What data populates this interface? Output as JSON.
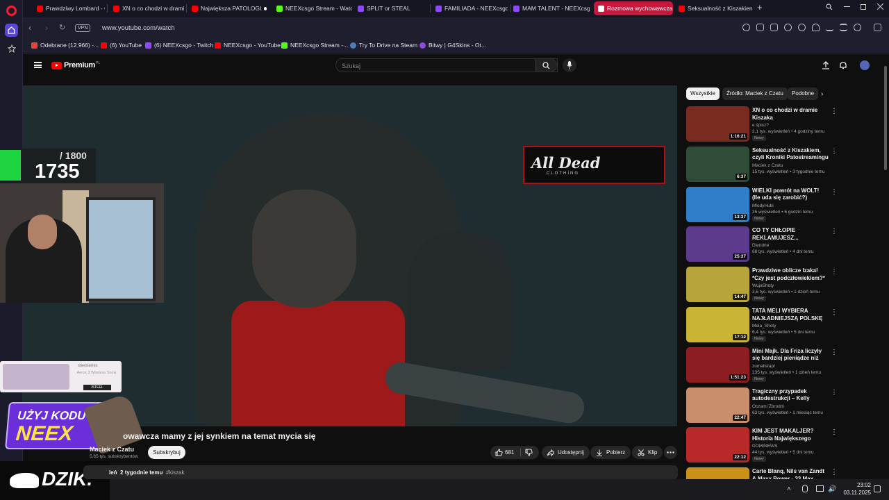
{
  "browser": {
    "tabs": [
      {
        "label": "Prawdziwy Lombard - Od",
        "icon": "youtube",
        "active": false
      },
      {
        "label": "XN o co chodzi w dramie",
        "icon": "youtube",
        "active": false
      },
      {
        "label": "Największa PATOLOGIA N",
        "icon": "youtube",
        "active": false
      },
      {
        "label": "NEEXcsgo Stream - Watch",
        "icon": "kick",
        "active": false
      },
      {
        "label": "SPLIT or STEAL",
        "icon": "twitch",
        "active": false
      },
      {
        "label": "FAMILIADA - NEEXcsgo",
        "icon": "twitch",
        "active": false
      },
      {
        "label": "MAM TALENT - NEEXcsgo",
        "icon": "twitch",
        "active": false
      },
      {
        "label": "Rozmowa wychowawcza",
        "icon": "youtube",
        "active": true
      },
      {
        "label": "Seksualność z Kiszakiem,",
        "icon": "youtube",
        "active": false
      }
    ],
    "new_tab": "+",
    "vpn": "VPN",
    "url": "www.youtube.com/watch",
    "bookmarks": [
      {
        "label": "Odebrane (12 966) -...",
        "icon": "gmail"
      },
      {
        "label": "(6) YouTube",
        "icon": "youtube"
      },
      {
        "label": "(6) NEEXcsgo - Twitch",
        "icon": "twitch"
      },
      {
        "label": "NEEXcsgo - YouTube",
        "icon": "youtube"
      },
      {
        "label": "NEEXcsgo Stream -...",
        "icon": "kick"
      },
      {
        "label": "Try To Drive na Steam",
        "icon": "steam"
      },
      {
        "label": "Bitwy | G4Skins - Ot...",
        "icon": "g4skins"
      }
    ]
  },
  "youtube": {
    "logo": "Premium",
    "logo_region": "PL",
    "search_placeholder": "Szukaj",
    "video": {
      "sponsor_title": "All Dead",
      "sponsor_sub": "CLOTHING",
      "title": "owawcza mamy z jej synkiem na temat mycia się",
      "channel": "Maciek z Czatu",
      "subscribers": "5,65 tys. subskrybentów",
      "subscribe_label": "Subskrybuj",
      "likes": "681",
      "share_label": "Udostępnij",
      "download_label": "Pobierz",
      "clip_label": "Klip",
      "desc_views": "leń",
      "desc_date": "2 tygodnie temu",
      "desc_tag": "#kiszak"
    },
    "overlay": {
      "goal": "/ 1800",
      "count": "1735",
      "steel_brand": "steelseries",
      "steel_product": "Aerox 3 Wireless Snow",
      "steel_cta": "ISTEEL",
      "code_line1": "UŻYJ KODU",
      "code_line2": "NEEX",
      "dzik": "DZIK."
    },
    "chips": [
      "Wszystkie",
      "Źródło: Maciek z Czatu",
      "Podobne"
    ],
    "recommendations": [
      {
        "title": "XN o co chodzi w dramie Kiszaka",
        "channel": "e śpisz?",
        "meta": "2,1 tys. wyświetleń • 4 godziny temu",
        "duration": "1:16:21",
        "badge": "Nowy",
        "color": "#7a2b1f"
      },
      {
        "title": "Seksualność z Kiszakiem, czyli Kroniki Patostreamingu w ...",
        "channel": "Maciek z Czatu",
        "meta": "15 tys. wyświetleń • 3 tygodnie temu",
        "duration": "6:37",
        "badge": "",
        "color": "#2e4c36"
      },
      {
        "title": "WIELKI powrót na WOLT! (Ile uda się zarobić?)",
        "channel": "MlodyHubi",
        "meta": "35 wyświetleń • 6 godzin temu",
        "duration": "13:37",
        "badge": "Nowy",
        "color": "#2f7ec9"
      },
      {
        "title": "CO TY CHŁOPIE REKLAMUJESZ...",
        "channel": "Diendrie",
        "meta": "68 tys. wyświetleń • 4 dni temu",
        "duration": "25:37",
        "badge": "",
        "color": "#5c3a8c"
      },
      {
        "title": "Prawdziwe oblicze Izaka! *Czy jest podczłowiekiem?*",
        "channel": "WujaShoty",
        "meta": "3,6 tys. wyświetleń • 1 dzień temu",
        "duration": "14:47",
        "badge": "Nowy",
        "color": "#b8a53a"
      },
      {
        "title": "TATA MELI WYBIERA NAJŁADNIEJSZĄ POLSKĘ ...",
        "channel": "Mela_Shoty",
        "meta": "6,4 tys. wyświetleń • 5 dni temu",
        "duration": "17:12",
        "badge": "Nowy",
        "color": "#c9b436"
      },
      {
        "title": "Mini Majk. Dla Friza liczyły się bardziej pieniądze niż ludzie",
        "channel": "zumalistap!",
        "meta": "235 tys. wyświetleń • 1 dzień temu",
        "duration": "1:51:23",
        "badge": "Nowy",
        "color": "#8c1e22"
      },
      {
        "title": "Tragiczny przypadek autodestrukcji – Kelly Ronahan",
        "channel": "Oczami Zbrodni",
        "meta": "63 tys. wyświetleń • 1 miesiąc temu",
        "duration": "22:47",
        "badge": "",
        "color": "#c98f6a"
      },
      {
        "title": "KIM JEST MAKALJER? Historia Największego Specjalisty AI w...",
        "channel": "DOMINEWS",
        "meta": "44 tys. wyświetleń • 5 dni temu",
        "duration": "22:12",
        "badge": "Nowy",
        "color": "#b82a2a"
      },
      {
        "title": "Carte Blanq, Nils van Zandt & Maxx Power - 33 Max ...",
        "channel": "",
        "meta": "",
        "duration": "",
        "badge": "",
        "color": "#c9901a"
      }
    ]
  },
  "taskbar": {
    "time": "23:02",
    "date": "03.11.2025"
  },
  "colors": {
    "yt_red": "#ff0000",
    "active_tab": "#c8173c",
    "opera_accent": "#5b45d6",
    "counter_green": "#1dd33f"
  }
}
